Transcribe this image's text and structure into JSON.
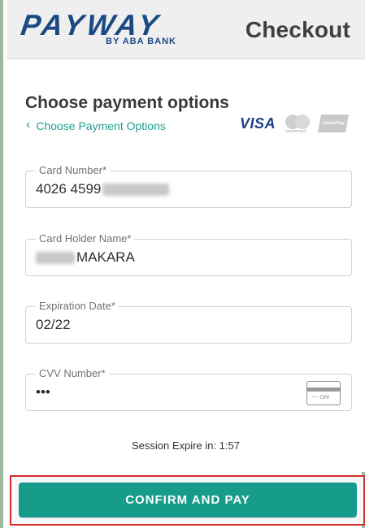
{
  "header": {
    "brand": "PAYWAY",
    "brand_sub": "BY ABA BANK",
    "title": "Checkout"
  },
  "payment": {
    "title": "Choose payment options",
    "back_label": "Choose Payment Options",
    "logos": {
      "visa": "VISA",
      "mastercard": "mastercard",
      "unionpay": "UnionPay"
    }
  },
  "fields": {
    "card_number": {
      "label": "Card Number*",
      "value": "4026 4599"
    },
    "holder_name": {
      "label": "Card Holder Name*",
      "value": "MAKARA"
    },
    "expiration": {
      "label": "Expiration Date*",
      "value": "02/22"
    },
    "cvv": {
      "label": "CVV Number*",
      "value": "•••"
    }
  },
  "session": {
    "text": "Session Expire in: 1:57"
  },
  "actions": {
    "confirm_pay": "CONFIRM AND PAY"
  },
  "colors": {
    "accent": "#179b8b",
    "brand": "#1a4a84",
    "highlight": "#d62b2b"
  }
}
